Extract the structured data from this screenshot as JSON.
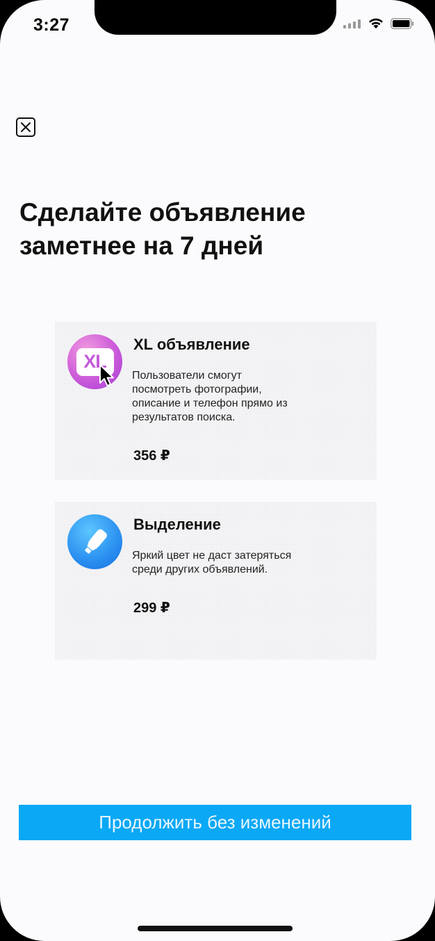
{
  "status_bar": {
    "time": "3:27"
  },
  "header": {
    "close_icon": "close-icon"
  },
  "headline": "Сделайте объявление заметнее на 7 дней",
  "options": [
    {
      "icon": "xl-icon",
      "icon_text": "XL",
      "title": "XL объявление",
      "description": "Пользователи смогут посмотреть фотографии, описание и телефон прямо из результатов поиска.",
      "price": "356 ₽"
    },
    {
      "icon": "highlighter-icon",
      "title": "Выделение",
      "description": "Яркий цвет не даст затеряться среди других объявлений.",
      "price": "299 ₽"
    }
  ],
  "footer": {
    "continue_label": "Продолжить без изменений"
  },
  "colors": {
    "accent": "#0aa8f5",
    "xl_icon": "#c45bd9",
    "highlight_icon": "#2a8ff0"
  }
}
